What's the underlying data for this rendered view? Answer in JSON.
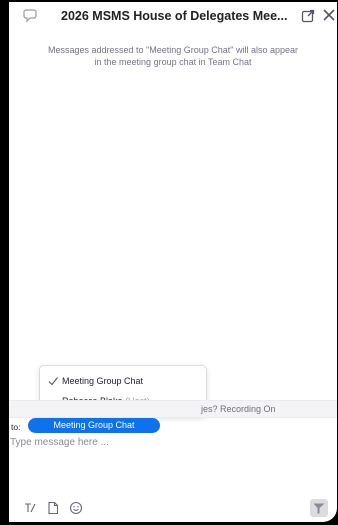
{
  "header": {
    "title": "2026 MSMS House of Delegates Mee..."
  },
  "info": {
    "text": "Messages addressed to \"Meeting Group Chat\" will also appear in the meeting group chat in Team Chat"
  },
  "recipient_menu": {
    "items": [
      {
        "label": "Meeting Group Chat",
        "selected": true,
        "suffix": ""
      },
      {
        "label": "Rebecca Blake",
        "selected": false,
        "suffix": "(Host)"
      }
    ]
  },
  "banner": {
    "text": "jes? Recording On"
  },
  "composer": {
    "to_label": "to:",
    "recipient": "Meeting Group Chat",
    "placeholder": "Type message here ..."
  },
  "colors": {
    "accent": "#0e72ed",
    "window_bg": "#ffffff",
    "frame_bg": "#000000"
  },
  "icons": {
    "header_left": "chat-bubble-icon",
    "popout": "popout-icon",
    "close": "close-icon",
    "format": "format-text-icon",
    "file": "file-icon",
    "emoji": "emoji-icon",
    "send": "send-icon",
    "check": "checkmark-icon"
  }
}
